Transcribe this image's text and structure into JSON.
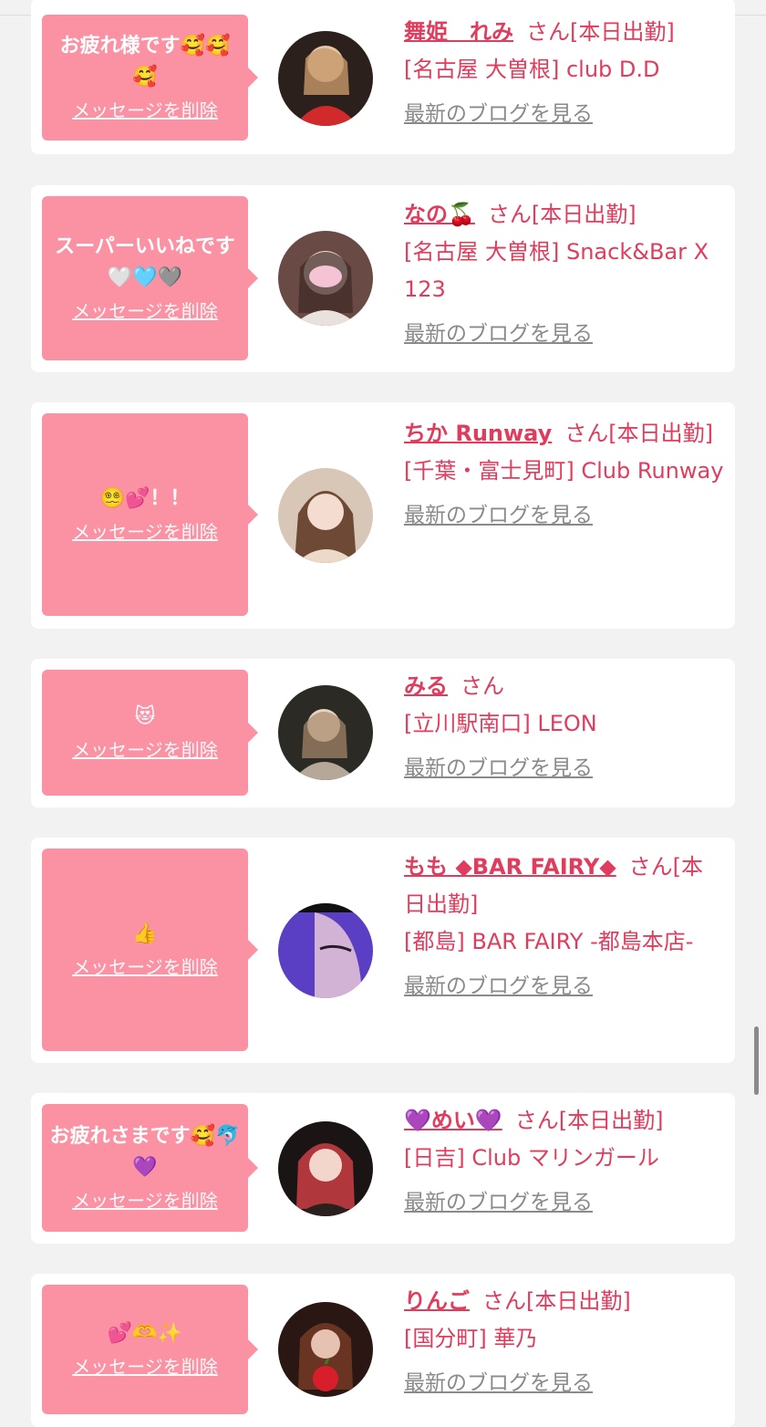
{
  "delete_label": "メッセージを削除",
  "blog_label": "最新のブログを見る",
  "colors": {
    "bubble": "#fb92a3",
    "accent": "#e03c5e",
    "link_gray": "#8a8a8a",
    "page_bg": "#f3f2f2"
  },
  "entries": [
    {
      "message": "お疲れ様です🥰🥰🥰",
      "name": "舞姫　れみ",
      "honorific": "さん[本日出勤]",
      "shop": "[名古屋 大曽根] club D.D"
    },
    {
      "message": "スーパーいいねです🤍🩵🩶",
      "name": "なの🍒",
      "honorific": "さん[本日出勤]",
      "shop": "[名古屋 大曽根] Snack&Bar X 123"
    },
    {
      "message": "😵‍💫💕！！",
      "name": "ちか Runway",
      "honorific": "さん[本日出勤]",
      "shop": "[千葉・富士見町] Club Runway"
    },
    {
      "message": "😻",
      "name": "みる",
      "honorific": "さん",
      "shop": "[立川駅南口] LEON"
    },
    {
      "message": "👍",
      "name": "もも ◆BAR FAIRY◆",
      "honorific": "さん[本日出勤]",
      "shop": "[都島] BAR FAIRY -都島本店-"
    },
    {
      "message": "お疲れさまです🥰🐬💜",
      "name": "💜めい💜",
      "honorific": "さん[本日出勤]",
      "shop": "[日吉] Club マリンガール"
    },
    {
      "message": "💕🫶✨",
      "name": "りんご",
      "honorific": "さん[本日出勤]",
      "shop": "[国分町] 華乃"
    }
  ]
}
